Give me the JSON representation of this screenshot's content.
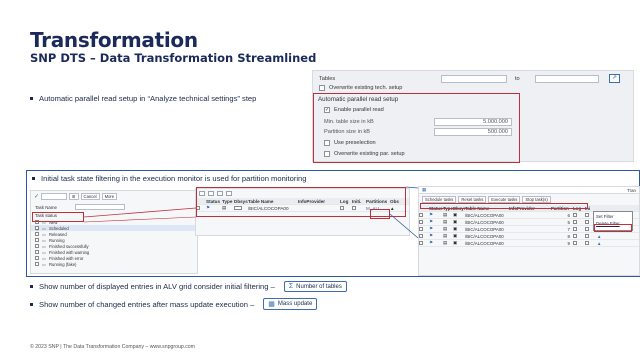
{
  "slide": {
    "title": "Transformation",
    "subtitle": "SNP DTS – Data Transformation Streamlined",
    "footer": "© 2023 SNP | The Data Transformation Company – www.snpgroup.com"
  },
  "bullets": {
    "b1": "Automatic parallel read setup in “Analyze technical settings” step",
    "b2": "Initial task state filtering in the execution monitor is used for partition monitoring",
    "b3": "Show number of displayed entries in ALV grid consider initial filtering –",
    "b3_chip": "Number of tables",
    "b4": "Show number of changed entries after mass update execution –",
    "b4_chip": "Mass update"
  },
  "settings_panel": {
    "tables_label": "Tables",
    "to_label": "to",
    "overwrite_setup": "Overwrite existing tech. setup",
    "group_title": "Automatic parallel read setup",
    "enable_parallel": "Enable parallel read",
    "min_table_size_label": "Min. table size in kB",
    "min_table_size_value": "5.000.000",
    "partition_size_label": "Partition size in kB",
    "partition_size_value": "500.000",
    "use_preselection": "Use preselection",
    "overwrite_par": "Overwrite existing par. setup"
  },
  "status_list": {
    "toolbar_refresh": "Cancel",
    "toolbar_more": "More",
    "task_name_label": "Task Name",
    "task_status_label": "Task status",
    "items": [
      "New",
      "Scheduled",
      "Released",
      "Running",
      "Finished successfully",
      "Finished with warning",
      "Finished with error",
      "Running (fake)"
    ]
  },
  "monitor_small": {
    "headers": [
      "Status",
      "Type",
      "Dbsys",
      "Table Name",
      "InfoProvider",
      "Log",
      "Initi.",
      "Partitions",
      "Obs"
    ],
    "row": {
      "table": "/BIC/ALCOCOPA00",
      "partitions": "M_ALL"
    }
  },
  "monitor_large": {
    "title_right": "Tran",
    "toolbar": [
      "Schedule tasks",
      "Reset tasks",
      "Execute tasks",
      "Stop task(s)"
    ],
    "headers": [
      "Status",
      "Type",
      "Dbsys",
      "Table Name",
      "InfoProvider",
      "Partition",
      "Log",
      "Ini"
    ],
    "rows": [
      {
        "table": "/BIC/ALCOCOPA00",
        "partition": "6"
      },
      {
        "table": "/BIC/ALCOCOPA00",
        "partition": "5"
      },
      {
        "table": "/BIC/ALCOCOPA00",
        "partition": "7"
      },
      {
        "table": "/BIC/ALCOCOPA00",
        "partition": "8"
      },
      {
        "table": "/BIC/ALCOCOPA00",
        "partition": "9"
      }
    ],
    "popup": [
      "Set Filter",
      "Delete Filter"
    ]
  }
}
